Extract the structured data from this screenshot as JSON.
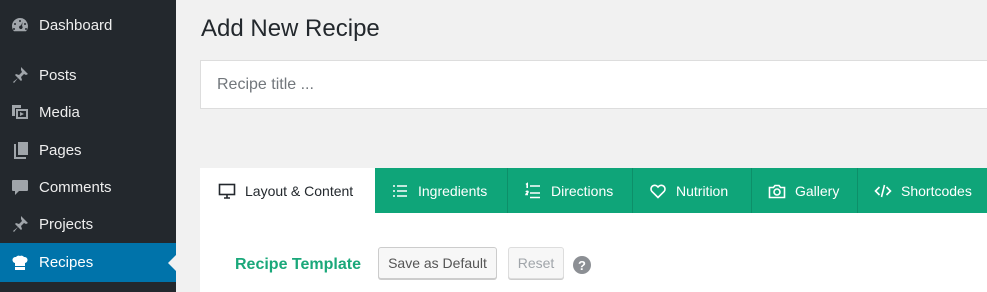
{
  "sidebar": {
    "items": [
      {
        "label": "Dashboard",
        "icon": "dashboard-icon",
        "active": false
      },
      {
        "label": "Posts",
        "icon": "pin-icon",
        "active": false
      },
      {
        "label": "Media",
        "icon": "media-icon",
        "active": false
      },
      {
        "label": "Pages",
        "icon": "pages-icon",
        "active": false
      },
      {
        "label": "Comments",
        "icon": "comment-icon",
        "active": false
      },
      {
        "label": "Projects",
        "icon": "pin-icon",
        "active": false
      },
      {
        "label": "Recipes",
        "icon": "chef-hat-icon",
        "active": true
      }
    ]
  },
  "main": {
    "page_title": "Add New Recipe",
    "title_placeholder": "Recipe title ...",
    "tabs": [
      {
        "label": "Layout & Content",
        "icon": "monitor-icon",
        "active": true
      },
      {
        "label": "Ingredients",
        "icon": "list-icon",
        "active": false
      },
      {
        "label": "Directions",
        "icon": "numbered-list-icon",
        "active": false
      },
      {
        "label": "Nutrition",
        "icon": "heart-icon",
        "active": false
      },
      {
        "label": "Gallery",
        "icon": "camera-icon",
        "active": false
      },
      {
        "label": "Shortcodes",
        "icon": "code-icon",
        "active": false
      }
    ],
    "recipe_template_label": "Recipe Template",
    "save_default_label": "Save as Default",
    "reset_label": "Reset",
    "help_glyph": "?"
  },
  "colors": {
    "sidebar_bg": "#23282d",
    "active_blue": "#0073aa",
    "tab_green": "#0fa579",
    "label_green": "#1aa87a"
  }
}
